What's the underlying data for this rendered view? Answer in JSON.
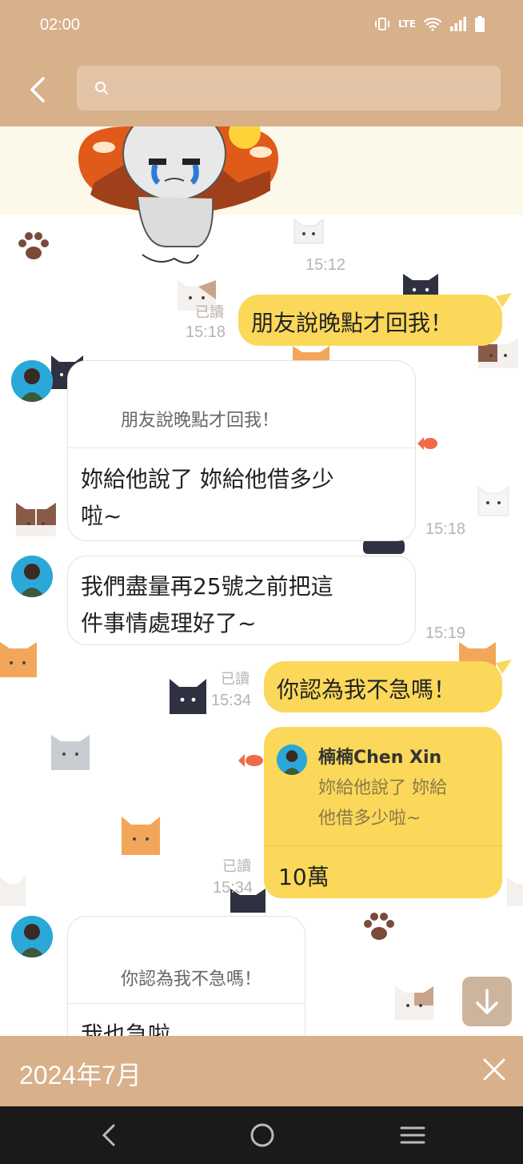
{
  "status": {
    "time": "02:00",
    "net_label": "LTE"
  },
  "search": {
    "placeholder": ""
  },
  "messages": {
    "sticker_time": "15:12",
    "m1": {
      "read": "已讀",
      "time": "15:18",
      "text": "朋友說晚點才回我！"
    },
    "m2": {
      "quote": "朋友說晚點才回我！",
      "text1": "妳給他說了  妳給他借多少",
      "text2": "啦~",
      "time": "15:18"
    },
    "m3": {
      "text1": "我們盡量再25號之前把這",
      "text2": "件事情處理好了~",
      "time": "15:19"
    },
    "m4": {
      "read": "已讀",
      "time": "15:34",
      "text": "你認為我不急嗎！"
    },
    "m5": {
      "read": "已讀",
      "time": "15:34",
      "quote_name": "楠楠Chen Xin",
      "quote_line1": "妳給他說了  妳給",
      "quote_line2": "他借多少啦~",
      "text": "10萬"
    },
    "m6": {
      "quote": "你認為我不急嗎！",
      "text": "我也急啦"
    }
  },
  "datebar": {
    "label": "2024年7月"
  },
  "colors": {
    "brand": "#d8b08a",
    "bubble_yellow": "#fbd85a",
    "navbar": "#1a1a1a"
  }
}
